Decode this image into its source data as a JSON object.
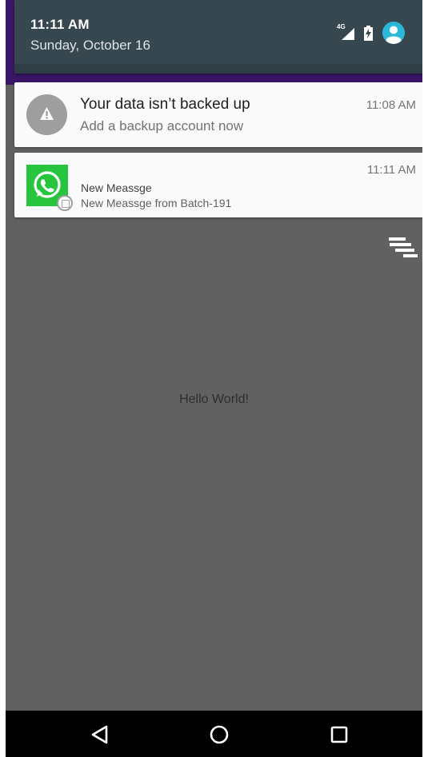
{
  "status": {
    "time": "11:11 AM",
    "date": "Sunday, October 16",
    "network_type": "4G",
    "icons": [
      "signal-icon",
      "battery-charging-icon",
      "user-avatar-icon"
    ],
    "accent": "#2bb8d8"
  },
  "notifications": [
    {
      "app": "system",
      "icon": "warning-icon",
      "title": "Your data isn’t backed up",
      "text": "Add a backup account now",
      "time": "11:08 AM"
    },
    {
      "app": "whatsapp",
      "icon": "whatsapp-icon",
      "title": "New Meassge",
      "text": "New Meassge from Batch-191",
      "time": "11:11 AM",
      "icon_color": "#27c53d"
    }
  ],
  "app": {
    "bar_color": "#3a1666",
    "content_text": "Hello World!"
  },
  "navigation": {
    "buttons": [
      "back-icon",
      "home-icon",
      "recents-icon"
    ]
  }
}
